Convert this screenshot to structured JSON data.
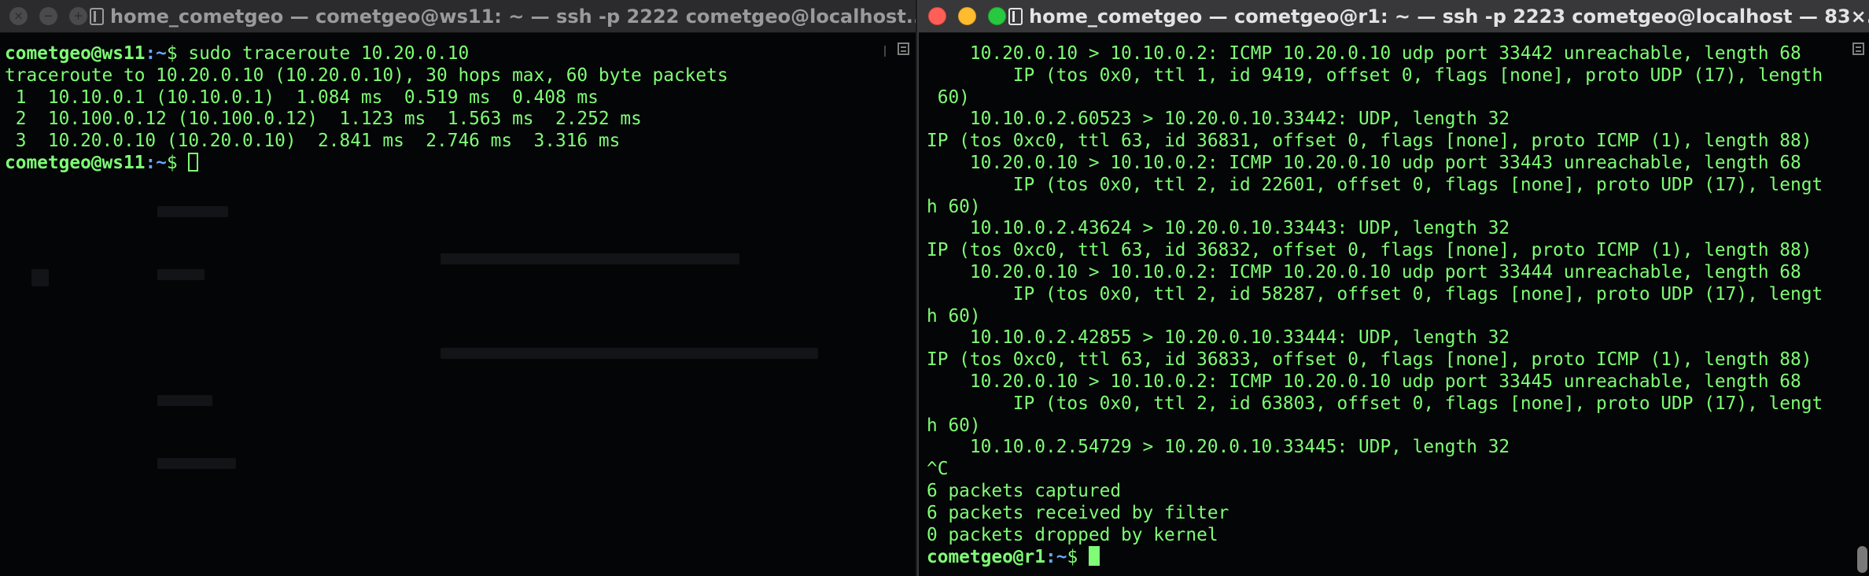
{
  "left_window": {
    "title": "home_cometgeo — cometgeo@ws11: ~ — ssh -p 2222 cometgeo@localhost...",
    "prompt": {
      "user_host": "cometgeo@ws11",
      "path": ":~",
      "symbol": "$ "
    },
    "command": "sudo traceroute 10.20.0.10",
    "output": [
      "traceroute to 10.20.0.10 (10.20.0.10), 30 hops max, 60 byte packets",
      " 1  10.10.0.1 (10.10.0.1)  1.084 ms  0.519 ms  0.408 ms",
      " 2  10.100.0.12 (10.100.0.12)  1.123 ms  1.563 ms  2.252 ms",
      " 3  10.20.0.10 (10.20.0.10)  2.841 ms  2.746 ms  3.316 ms"
    ]
  },
  "right_window": {
    "title": "home_cometgeo — cometgeo@r1: ~ — ssh -p 2223 cometgeo@localhost — 83×...",
    "prompt": {
      "user_host": "cometgeo@r1",
      "path": ":~",
      "symbol": "$ "
    },
    "output": [
      "    10.20.0.10 > 10.10.0.2: ICMP 10.20.0.10 udp port 33442 unreachable, length 68",
      "        IP (tos 0x0, ttl 1, id 9419, offset 0, flags [none], proto UDP (17), length",
      " 60)",
      "    10.10.0.2.60523 > 10.20.0.10.33442: UDP, length 32",
      "IP (tos 0xc0, ttl 63, id 36831, offset 0, flags [none], proto ICMP (1), length 88)",
      "    10.20.0.10 > 10.10.0.2: ICMP 10.20.0.10 udp port 33443 unreachable, length 68",
      "        IP (tos 0x0, ttl 2, id 22601, offset 0, flags [none], proto UDP (17), lengt",
      "h 60)",
      "    10.10.0.2.43624 > 10.20.0.10.33443: UDP, length 32",
      "IP (tos 0xc0, ttl 63, id 36832, offset 0, flags [none], proto ICMP (1), length 88)",
      "    10.20.0.10 > 10.10.0.2: ICMP 10.20.0.10 udp port 33444 unreachable, length 68",
      "        IP (tos 0x0, ttl 2, id 58287, offset 0, flags [none], proto UDP (17), lengt",
      "h 60)",
      "    10.10.0.2.42855 > 10.20.0.10.33444: UDP, length 32",
      "IP (tos 0xc0, ttl 63, id 36833, offset 0, flags [none], proto ICMP (1), length 88)",
      "    10.20.0.10 > 10.10.0.2: ICMP 10.20.0.10 udp port 33445 unreachable, length 68",
      "        IP (tos 0x0, ttl 2, id 63803, offset 0, flags [none], proto UDP (17), lengt",
      "h 60)",
      "    10.10.0.2.54729 > 10.20.0.10.33445: UDP, length 32",
      "^C",
      "6 packets captured",
      "6 packets received by filter",
      "0 packets dropped by kernel"
    ]
  },
  "icons": {
    "window_icon": "terminal-folder-icon",
    "scroll_mark": "scroll-marks-icon"
  },
  "colors": {
    "terminal_bg": "#040506",
    "text_green": "#7ffd76",
    "path_blue": "#66a8ff",
    "close": "#ff5f57",
    "minimize": "#febc2e",
    "maximize": "#28c840"
  }
}
